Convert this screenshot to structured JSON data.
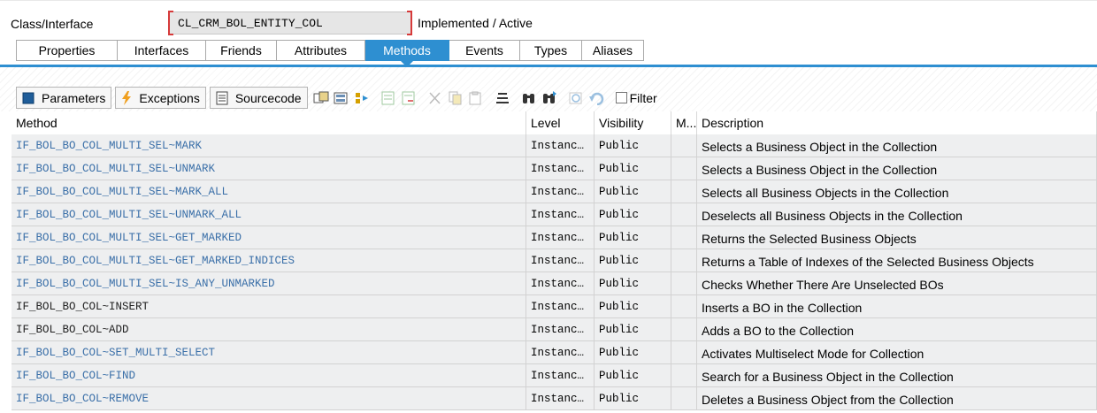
{
  "header": {
    "label": "Class/Interface",
    "class_name": "CL_CRM_BOL_ENTITY_COL",
    "status": "Implemented / Active"
  },
  "tabs": [
    {
      "label": "Properties",
      "active": false
    },
    {
      "label": "Interfaces",
      "active": false
    },
    {
      "label": "Friends",
      "active": false
    },
    {
      "label": "Attributes",
      "active": false
    },
    {
      "label": "Methods",
      "active": true
    },
    {
      "label": "Events",
      "active": false
    },
    {
      "label": "Types",
      "active": false
    },
    {
      "label": "Aliases",
      "active": false
    }
  ],
  "toolbar": {
    "parameters": "Parameters",
    "exceptions": "Exceptions",
    "sourcecode": "Sourcecode",
    "filter": "Filter",
    "accent": "#2e8fd1",
    "icons": [
      "where-used-icon",
      "display-object-list-icon",
      "navigate-icon",
      "insert-row-icon",
      "delete-row-icon",
      "cut-icon",
      "copy-icon",
      "paste-icon",
      "align-icon",
      "find-icon",
      "find-next-icon",
      "disabled-icon",
      "undo-icon"
    ]
  },
  "grid": {
    "columns": {
      "method": "Method",
      "level": "Level",
      "visibility": "Visibility",
      "m": "M...",
      "description": "Description"
    },
    "rows": [
      {
        "method": "IF_BOL_BO_COL_MULTI_SEL~MARK",
        "level": "Instanc…",
        "visibility": "Public",
        "m": "",
        "description": "Selects a Business Object in the Collection",
        "link": true
      },
      {
        "method": "IF_BOL_BO_COL_MULTI_SEL~UNMARK",
        "level": "Instanc…",
        "visibility": "Public",
        "m": "",
        "description": "Selects a Business Object in the Collection",
        "link": true
      },
      {
        "method": "IF_BOL_BO_COL_MULTI_SEL~MARK_ALL",
        "level": "Instanc…",
        "visibility": "Public",
        "m": "",
        "description": "Selects all Business Objects in the Collection",
        "link": true
      },
      {
        "method": "IF_BOL_BO_COL_MULTI_SEL~UNMARK_ALL",
        "level": "Instanc…",
        "visibility": "Public",
        "m": "",
        "description": "Deselects all Business Objects in the Collection",
        "link": true
      },
      {
        "method": "IF_BOL_BO_COL_MULTI_SEL~GET_MARKED",
        "level": "Instanc…",
        "visibility": "Public",
        "m": "",
        "description": "Returns the Selected Business Objects",
        "link": true
      },
      {
        "method": "IF_BOL_BO_COL_MULTI_SEL~GET_MARKED_INDICES",
        "level": "Instanc…",
        "visibility": "Public",
        "m": "",
        "description": "Returns a Table of Indexes of the Selected Business Objects",
        "link": true
      },
      {
        "method": "IF_BOL_BO_COL_MULTI_SEL~IS_ANY_UNMARKED",
        "level": "Instanc…",
        "visibility": "Public",
        "m": "",
        "description": "Checks Whether There Are Unselected BOs",
        "link": true
      },
      {
        "method": "IF_BOL_BO_COL~INSERT",
        "level": "Instanc…",
        "visibility": "Public",
        "m": "",
        "description": "Inserts a BO in the Collection",
        "link": false
      },
      {
        "method": "IF_BOL_BO_COL~ADD",
        "level": "Instanc…",
        "visibility": "Public",
        "m": "",
        "description": "Adds a BO to the Collection",
        "link": false
      },
      {
        "method": "IF_BOL_BO_COL~SET_MULTI_SELECT",
        "level": "Instanc…",
        "visibility": "Public",
        "m": "",
        "description": "Activates Multiselect Mode for Collection",
        "link": true
      },
      {
        "method": "IF_BOL_BO_COL~FIND",
        "level": "Instanc…",
        "visibility": "Public",
        "m": "",
        "description": "Search for a Business Object in the Collection",
        "link": true
      },
      {
        "method": "IF_BOL_BO_COL~REMOVE",
        "level": "Instanc…",
        "visibility": "Public",
        "m": "",
        "description": "Deletes a Business Object from the Collection",
        "link": true
      }
    ]
  }
}
